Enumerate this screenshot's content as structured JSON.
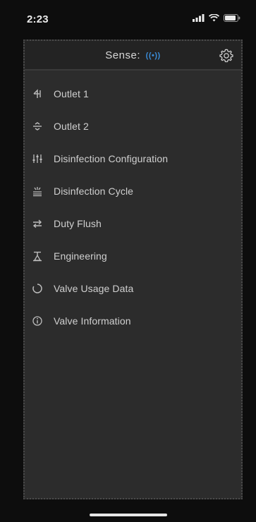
{
  "status_bar": {
    "time": "2:23"
  },
  "header": {
    "title": "Sense:",
    "badge": "((•))"
  },
  "menu": {
    "items": [
      {
        "label": "Outlet 1",
        "icon": "outlet-1-icon"
      },
      {
        "label": "Outlet 2",
        "icon": "outlet-2-icon"
      },
      {
        "label": "Disinfection Configuration",
        "icon": "sliders-icon"
      },
      {
        "label": "Disinfection Cycle",
        "icon": "disinfection-cycle-icon"
      },
      {
        "label": "Duty Flush",
        "icon": "flush-arrows-icon"
      },
      {
        "label": "Engineering",
        "icon": "engineering-icon"
      },
      {
        "label": "Valve Usage Data",
        "icon": "usage-ring-icon"
      },
      {
        "label": "Valve Information",
        "icon": "info-icon"
      }
    ]
  },
  "colors": {
    "panel_background": "#2c2c2c",
    "header_background": "#232323",
    "text": "#d0d0d0",
    "accent": "#3a8bd6"
  }
}
